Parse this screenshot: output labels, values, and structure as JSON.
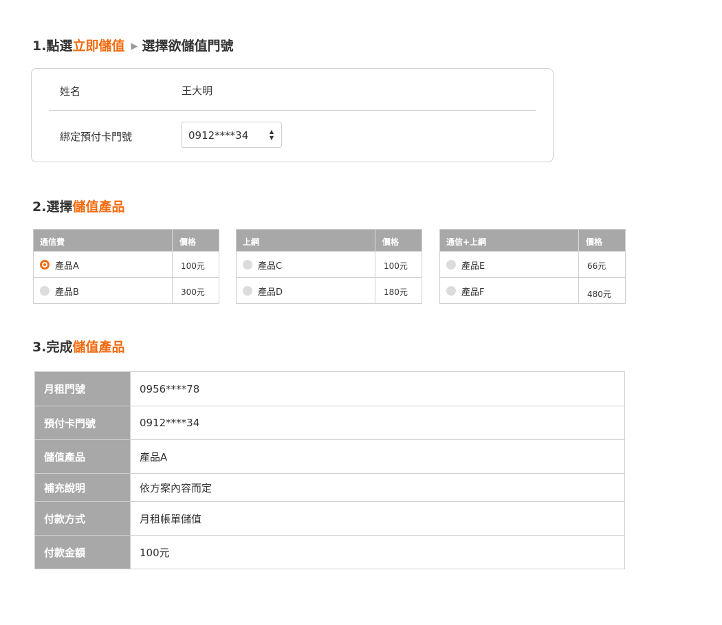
{
  "step1": {
    "prefix": "1.點選",
    "accent": "立即儲值",
    "arrow": "▶",
    "suffix": "選擇欲儲值門號",
    "name_label": "姓名",
    "name_value": "王大明",
    "number_label": "綁定預付卡門號",
    "number_value": "0912****34",
    "select_icon": "up-down-caret-icon"
  },
  "step2": {
    "prefix": "2.選擇",
    "accent": "儲值產品",
    "tables": [
      {
        "category": "通信費",
        "price_header": "價格",
        "rows": [
          {
            "name": "產品A",
            "price": "100元",
            "selected": true
          },
          {
            "name": "產品B",
            "price": "300元",
            "selected": false
          }
        ]
      },
      {
        "category": "上網",
        "price_header": "價格",
        "rows": [
          {
            "name": "產品C",
            "price": "100元",
            "selected": false
          },
          {
            "name": "產品D",
            "price": "180元",
            "selected": false
          }
        ]
      },
      {
        "category": "通信+上網",
        "price_header": "價格",
        "rows": [
          {
            "name": "產品E",
            "price": "66元",
            "selected": false
          },
          {
            "name": "產品F",
            "price": "480元",
            "selected": false
          }
        ]
      }
    ]
  },
  "step3": {
    "prefix": "3.完成",
    "accent": "儲值產品",
    "rows": [
      {
        "label": "月租門號",
        "value": "0956****78"
      },
      {
        "label": "預付卡門號",
        "value": "0912****34"
      },
      {
        "label": "儲值產品",
        "value": "產品A"
      },
      {
        "label": "補充說明",
        "value": "依方案內容而定"
      },
      {
        "label": "付款方式",
        "value": "月租帳單儲值"
      },
      {
        "label": "付款金額",
        "value": "100元"
      }
    ]
  },
  "colors": {
    "accent": "#f26b10",
    "header_gray": "#a8a8a8",
    "border": "#cfcfcf"
  }
}
